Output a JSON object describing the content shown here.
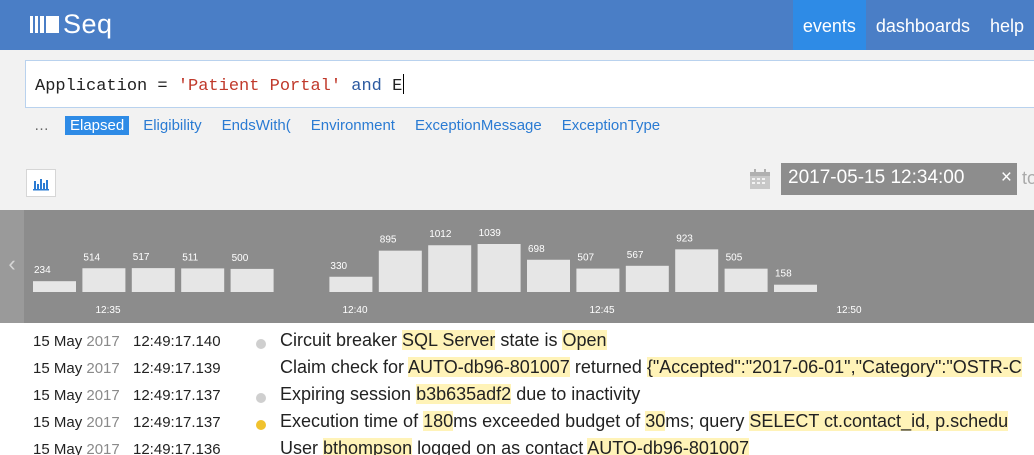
{
  "app": {
    "logo_text": "Seq",
    "nav": [
      {
        "label": "events",
        "active": true
      },
      {
        "label": "dashboards",
        "active": false
      },
      {
        "label": "help",
        "active": false
      }
    ]
  },
  "search": {
    "query_tokens": [
      {
        "text": "Application",
        "kind": "prop"
      },
      {
        "text": " = ",
        "kind": "op"
      },
      {
        "text": "'Patient Portal'",
        "kind": "str"
      },
      {
        "text": " ",
        "kind": "op"
      },
      {
        "text": "and",
        "kind": "kw"
      },
      {
        "text": " E",
        "kind": "op"
      }
    ],
    "suggestions_ellipsis": "…",
    "suggestions": [
      {
        "label": "Elapsed",
        "selected": true
      },
      {
        "label": "Eligibility",
        "selected": false
      },
      {
        "label": "EndsWith(",
        "selected": false
      },
      {
        "label": "Environment",
        "selected": false
      },
      {
        "label": "ExceptionMessage",
        "selected": false
      },
      {
        "label": "ExceptionType",
        "selected": false
      }
    ]
  },
  "range": {
    "from": "2017-05-15 12:34:00",
    "clear_glyph": "×",
    "to_label": "to"
  },
  "histogram": {
    "bars": [
      234,
      514,
      517,
      511,
      500,
      0,
      330,
      895,
      1012,
      1039,
      698,
      507,
      567,
      923,
      505,
      158
    ],
    "ticks": [
      "12:35",
      "12:40",
      "12:45",
      "12:50"
    ],
    "colors": {
      "background": "#8c8c8c",
      "bar": "#e6e6e6",
      "label": "#ffffff"
    }
  },
  "events": [
    {
      "day": "15 May",
      "year": "2017",
      "time": "12:49:17.140",
      "level": "info",
      "parts": [
        {
          "t": "Circuit breaker "
        },
        {
          "t": "SQL Server",
          "h": true
        },
        {
          "t": " state is "
        },
        {
          "t": "Open",
          "h": true
        }
      ]
    },
    {
      "day": "15 May",
      "year": "2017",
      "time": "12:49:17.139",
      "level": "none",
      "parts": [
        {
          "t": "Claim check for "
        },
        {
          "t": "AUTO-db96-801007",
          "h": true
        },
        {
          "t": " returned "
        },
        {
          "t": "{\"Accepted\":\"2017-06-01\",\"Category\":\"OSTR-C",
          "h": true
        }
      ]
    },
    {
      "day": "15 May",
      "year": "2017",
      "time": "12:49:17.137",
      "level": "info",
      "parts": [
        {
          "t": "Expiring session "
        },
        {
          "t": "b3b635adf2",
          "h": true
        },
        {
          "t": " due to inactivity"
        }
      ]
    },
    {
      "day": "15 May",
      "year": "2017",
      "time": "12:49:17.137",
      "level": "warning",
      "parts": [
        {
          "t": "Execution time of "
        },
        {
          "t": "180",
          "h": true
        },
        {
          "t": "ms exceeded budget of "
        },
        {
          "t": "30",
          "h": true
        },
        {
          "t": "ms; query "
        },
        {
          "t": "SELECT ct.contact_id, p.schedu",
          "h": true
        }
      ]
    },
    {
      "day": "15 May",
      "year": "2017",
      "time": "12:49:17.136",
      "level": "none",
      "parts": [
        {
          "t": "User "
        },
        {
          "t": "bthompson",
          "h": true
        },
        {
          "t": " logged on as contact "
        },
        {
          "t": "AUTO-db96-801007",
          "h": true
        }
      ]
    }
  ],
  "level_colors": {
    "info": "#cfcfcf",
    "warning": "#f0c22e",
    "none": "transparent"
  }
}
